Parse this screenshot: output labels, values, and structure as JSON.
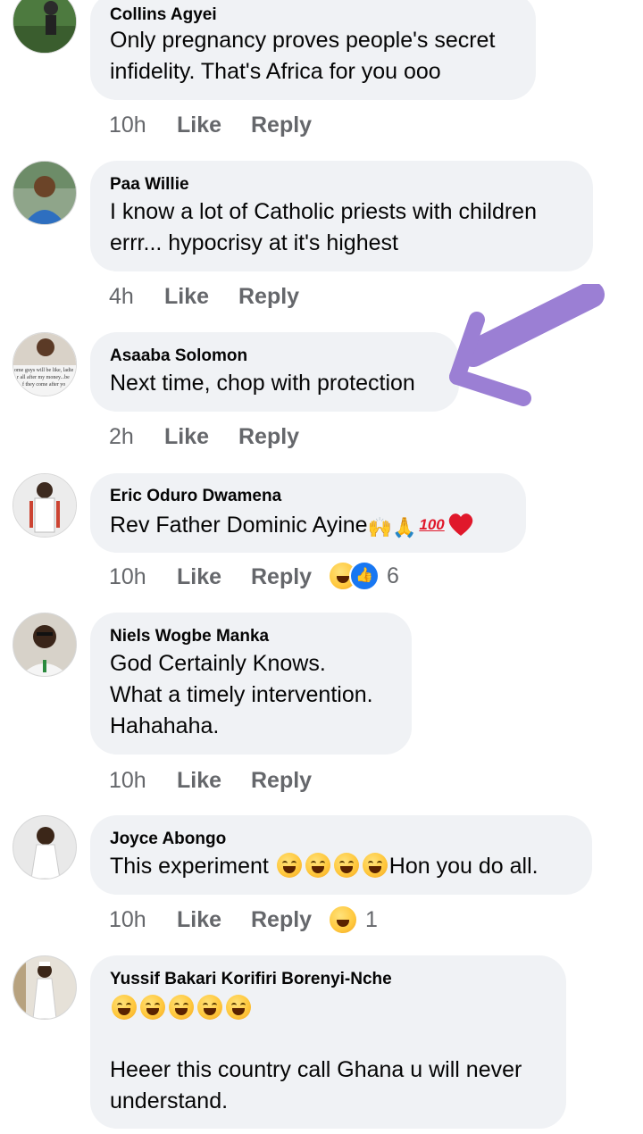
{
  "comments": [
    {
      "author": "Collins Agyei",
      "lines": [
        "Only pregnancy proves people's secret",
        "infidelity. That's Africa for you ooo"
      ],
      "time": "10h",
      "like": "Like",
      "reply": "Reply"
    },
    {
      "author": "Paa Willie",
      "lines": [
        "I know a lot of Catholic priests with children",
        "errr... hypocrisy at it's highest"
      ],
      "time": "4h",
      "like": "Like",
      "reply": "Reply"
    },
    {
      "author": "Asaaba Solomon",
      "avatar_caption": [
        "ome guys will be like, ladie",
        "r all after my money...be",
        "f they come after yo"
      ],
      "lines": [
        "Next time, chop with protection"
      ],
      "time": "2h",
      "like": "Like",
      "reply": "Reply"
    },
    {
      "author": "Eric Oduro Dwamena",
      "text": "Rev Father Dominic Ayine",
      "emoji": [
        "raising-hands",
        "folded-hands",
        "hundred-points",
        "red-heart"
      ],
      "hundred": "100",
      "time": "10h",
      "like": "Like",
      "reply": "Reply",
      "reactions": [
        "haha",
        "like"
      ],
      "reaction_count": "6"
    },
    {
      "author": "Niels Wogbe Manka",
      "lines": [
        "God Certainly Knows.",
        "What a timely intervention.",
        "Hahahaha."
      ],
      "time": "10h",
      "like": "Like",
      "reply": "Reply"
    },
    {
      "author": "Joyce Abongo",
      "text_before": "This experiment ",
      "emoji": [
        "tears-of-joy",
        "tears-of-joy",
        "tears-of-joy",
        "tears-of-joy"
      ],
      "text_after": "Hon you do all.",
      "time": "10h",
      "like": "Like",
      "reply": "Reply",
      "reactions": [
        "haha"
      ],
      "reaction_count": "1"
    },
    {
      "author": "Yussif Bakari Korifiri Borenyi-Nche",
      "emoji": [
        "tears-of-joy",
        "tears-of-joy",
        "tears-of-joy",
        "tears-of-joy",
        "tears-of-joy"
      ],
      "lines": [
        "Heeer this country call Ghana u will never",
        "understand."
      ]
    }
  ],
  "annotation": {
    "arrow_color": "#9b7fd4"
  },
  "colors": {
    "bubble": "#f0f2f5",
    "meta": "#65676b",
    "like_blue": "#1877f2"
  }
}
